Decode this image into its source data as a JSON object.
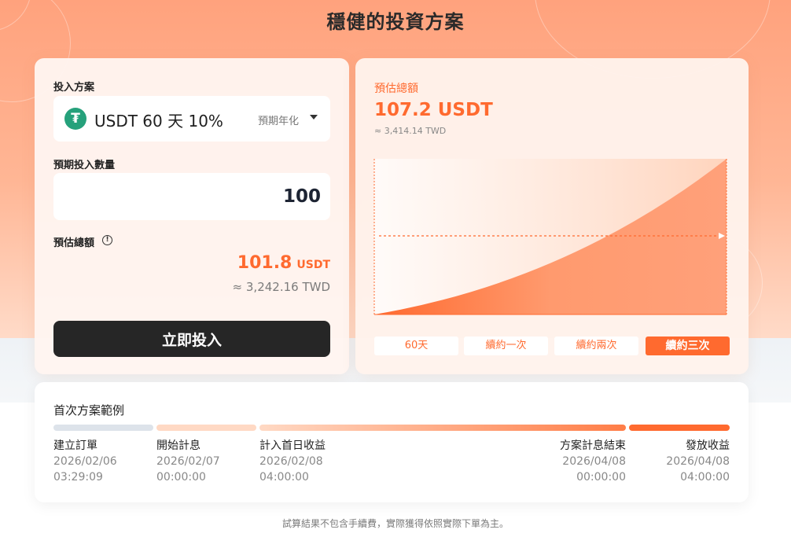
{
  "page": {
    "title": "穩健的投資方案"
  },
  "left_card": {
    "plan_label": "投入方案",
    "plan": {
      "icon": "tether-icon",
      "name": "USDT 60 天 10%",
      "hint": "預期年化"
    },
    "quantity_label": "預期投入數量",
    "quantity_value": "100",
    "estimate_label": "預估總額",
    "estimate_value": "101.8",
    "estimate_unit": "USDT",
    "estimate_twd": "≈ 3,242.16 TWD",
    "invest_button": "立即投入"
  },
  "right_card": {
    "title": "預估總額",
    "value": "107.2 USDT",
    "twd": "≈ 3,414.14 TWD",
    "tabs": [
      {
        "label": "60天",
        "active": false
      },
      {
        "label": "續約一次",
        "active": false
      },
      {
        "label": "續約兩次",
        "active": false
      },
      {
        "label": "續約三次",
        "active": true
      }
    ]
  },
  "timeline": {
    "title": "首次方案範例",
    "steps": [
      {
        "label": "建立訂單",
        "date": "2026/02/06",
        "time": "03:29:09"
      },
      {
        "label": "開始計息",
        "date": "2026/02/07",
        "time": "00:00:00"
      },
      {
        "label": "計入首日收益",
        "date": "2026/02/08",
        "time": "04:00:00"
      },
      {
        "label": "方案計息結束",
        "date": "2026/04/08",
        "time": "00:00:00"
      },
      {
        "label": "發放收益",
        "date": "2026/04/08",
        "time": "04:00:00"
      }
    ]
  },
  "footnote": "試算結果不包含手續費，實際獲得依照實際下單為主。",
  "colors": {
    "accent": "#ff6a2f",
    "button_dark": "#262626",
    "tether": "#26a17b"
  }
}
